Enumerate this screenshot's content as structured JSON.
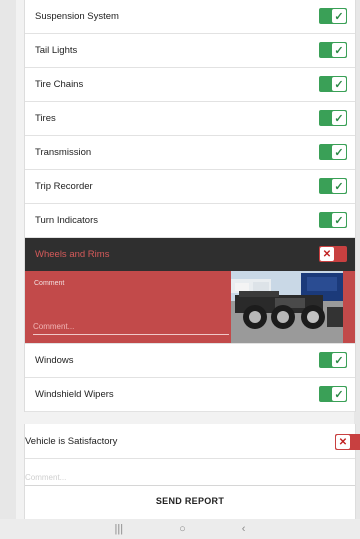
{
  "checklist": {
    "items": [
      {
        "label": "Suspension System",
        "ok": true
      },
      {
        "label": "Tail Lights",
        "ok": true
      },
      {
        "label": "Tire Chains",
        "ok": true
      },
      {
        "label": "Tires",
        "ok": true
      },
      {
        "label": "Transmission",
        "ok": true
      },
      {
        "label": "Trip Recorder",
        "ok": true
      },
      {
        "label": "Turn Indicators",
        "ok": true
      }
    ],
    "failed_item": {
      "label": "Wheels and Rims",
      "ok": false
    },
    "comment_label": "Comment",
    "comment_placeholder": "Comment...",
    "after_items": [
      {
        "label": "Windows",
        "ok": true
      },
      {
        "label": "Windshield Wipers",
        "ok": true
      }
    ]
  },
  "report": {
    "satisfactory_label": "Vehicle is Satisfactory",
    "satisfactory_ok": false,
    "comment_placeholder": "Comment...",
    "send_label": "SEND REPORT"
  },
  "icons": {
    "check": "✓",
    "cross": "✕",
    "nav_recent": "|||",
    "nav_home": "○",
    "nav_back": "‹"
  },
  "colors": {
    "toggle_on": "#3aa057",
    "toggle_off": "#c84040",
    "failed_row": "#2f2f2f",
    "comment_panel": "#c24a4a"
  }
}
